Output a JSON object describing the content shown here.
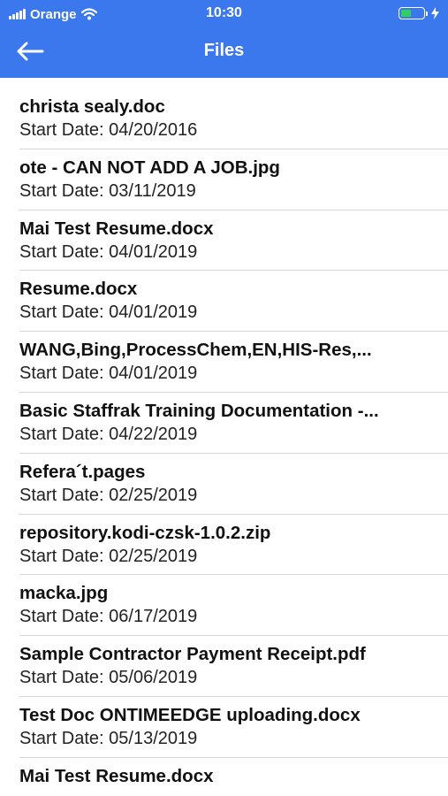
{
  "status_bar": {
    "carrier": "Orange",
    "time": "10:30",
    "battery_level": 0.45,
    "battery_fill_color": "#2fd158",
    "icons": [
      "signal-icon",
      "wifi-icon",
      "battery-icon",
      "charging-icon"
    ]
  },
  "nav": {
    "back_icon": "arrow-left-icon",
    "title": "Files",
    "background_color": "#3b78ed"
  },
  "files": [
    {
      "name": "christa sealy.doc",
      "date": "Start Date: 04/20/2016"
    },
    {
      "name": "ote - CAN NOT ADD A JOB.jpg",
      "date": "Start Date: 03/11/2019"
    },
    {
      "name": "Mai Test Resume.docx",
      "date": "Start Date: 04/01/2019"
    },
    {
      "name": "Resume.docx",
      "date": "Start Date: 04/01/2019"
    },
    {
      "name": "WANG,Bing,ProcessChem,EN,HIS-Res,...",
      "date": "Start Date: 04/01/2019"
    },
    {
      "name": "Basic Staffrak Training Documentation -...",
      "date": "Start Date: 04/22/2019"
    },
    {
      "name": "Refera´t.pages",
      "date": "Start Date: 02/25/2019"
    },
    {
      "name": "repository.kodi-czsk-1.0.2.zip",
      "date": "Start Date: 02/25/2019"
    },
    {
      "name": "macka.jpg",
      "date": "Start Date: 06/17/2019"
    },
    {
      "name": "Sample Contractor Payment Receipt.pdf",
      "date": "Start Date: 05/06/2019"
    },
    {
      "name": "Test Doc ONTIMEEDGE uploading.docx",
      "date": "Start Date: 05/13/2019"
    },
    {
      "name": "Mai Test Resume.docx",
      "date": ""
    }
  ]
}
